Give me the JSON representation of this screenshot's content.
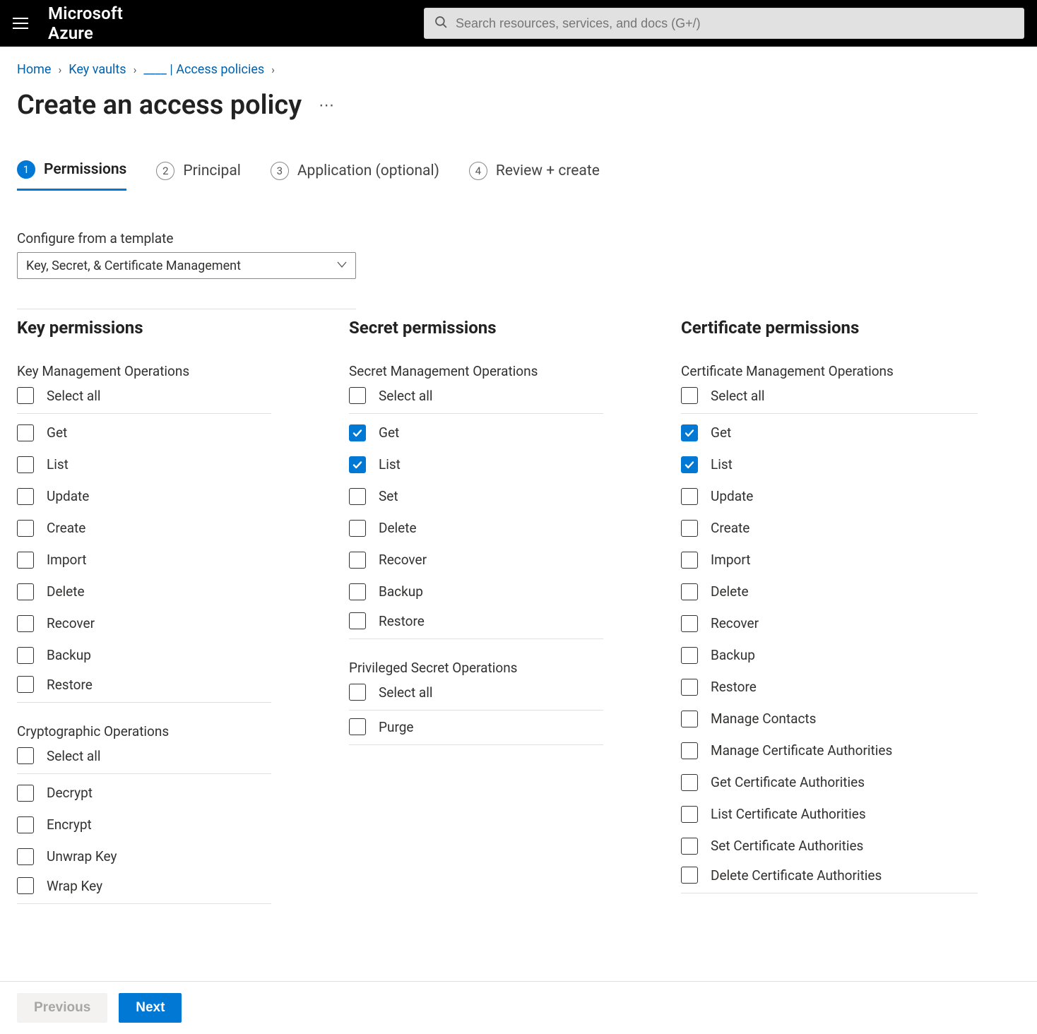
{
  "header": {
    "brand": "Microsoft Azure",
    "search_placeholder": "Search resources, services, and docs (G+/)"
  },
  "breadcrumbs": {
    "items": [
      "Home",
      "Key vaults",
      "____ | Access policies"
    ]
  },
  "page": {
    "title": "Create an access policy"
  },
  "tabs": [
    {
      "num": "1",
      "label": "Permissions",
      "active": true
    },
    {
      "num": "2",
      "label": "Principal",
      "active": false
    },
    {
      "num": "3",
      "label": "Application (optional)",
      "active": false
    },
    {
      "num": "4",
      "label": "Review + create",
      "active": false
    }
  ],
  "template": {
    "label": "Configure from a template",
    "value": "Key, Secret, & Certificate Management"
  },
  "columns": {
    "key": {
      "heading": "Key permissions",
      "groups": [
        {
          "label": "Key Management Operations",
          "select_all": {
            "label": "Select all",
            "checked": false
          },
          "items": [
            {
              "label": "Get",
              "checked": false
            },
            {
              "label": "List",
              "checked": false
            },
            {
              "label": "Update",
              "checked": false
            },
            {
              "label": "Create",
              "checked": false
            },
            {
              "label": "Import",
              "checked": false
            },
            {
              "label": "Delete",
              "checked": false
            },
            {
              "label": "Recover",
              "checked": false
            },
            {
              "label": "Backup",
              "checked": false
            },
            {
              "label": "Restore",
              "checked": false
            }
          ]
        },
        {
          "label": "Cryptographic Operations",
          "select_all": {
            "label": "Select all",
            "checked": false
          },
          "items": [
            {
              "label": "Decrypt",
              "checked": false
            },
            {
              "label": "Encrypt",
              "checked": false
            },
            {
              "label": "Unwrap Key",
              "checked": false
            },
            {
              "label": "Wrap Key",
              "checked": false
            }
          ]
        }
      ]
    },
    "secret": {
      "heading": "Secret permissions",
      "groups": [
        {
          "label": "Secret Management Operations",
          "select_all": {
            "label": "Select all",
            "checked": false
          },
          "items": [
            {
              "label": "Get",
              "checked": true
            },
            {
              "label": "List",
              "checked": true
            },
            {
              "label": "Set",
              "checked": false
            },
            {
              "label": "Delete",
              "checked": false
            },
            {
              "label": "Recover",
              "checked": false
            },
            {
              "label": "Backup",
              "checked": false
            },
            {
              "label": "Restore",
              "checked": false
            }
          ]
        },
        {
          "label": "Privileged Secret Operations",
          "select_all": {
            "label": "Select all",
            "checked": false
          },
          "items": [
            {
              "label": "Purge",
              "checked": false
            }
          ]
        }
      ]
    },
    "cert": {
      "heading": "Certificate permissions",
      "groups": [
        {
          "label": "Certificate Management Operations",
          "select_all": {
            "label": "Select all",
            "checked": false
          },
          "items": [
            {
              "label": "Get",
              "checked": true
            },
            {
              "label": "List",
              "checked": true
            },
            {
              "label": "Update",
              "checked": false
            },
            {
              "label": "Create",
              "checked": false
            },
            {
              "label": "Import",
              "checked": false
            },
            {
              "label": "Delete",
              "checked": false
            },
            {
              "label": "Recover",
              "checked": false
            },
            {
              "label": "Backup",
              "checked": false
            },
            {
              "label": "Restore",
              "checked": false
            },
            {
              "label": "Manage Contacts",
              "checked": false
            },
            {
              "label": "Manage Certificate Authorities",
              "checked": false
            },
            {
              "label": "Get Certificate Authorities",
              "checked": false
            },
            {
              "label": "List Certificate Authorities",
              "checked": false
            },
            {
              "label": "Set Certificate Authorities",
              "checked": false
            },
            {
              "label": "Delete Certificate Authorities",
              "checked": false
            }
          ]
        }
      ]
    }
  },
  "footer": {
    "previous": "Previous",
    "next": "Next"
  }
}
